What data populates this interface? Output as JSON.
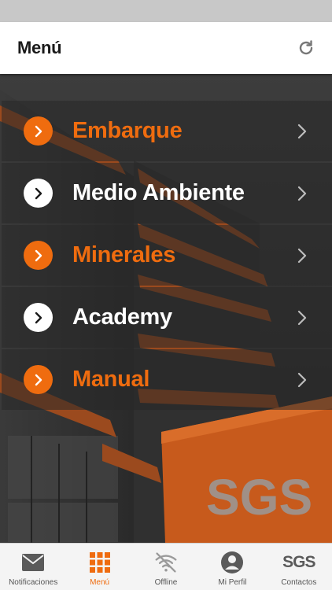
{
  "header": {
    "title": "Menú",
    "refresh_icon": "refresh-icon"
  },
  "colors": {
    "accent": "#ef6c0f",
    "header_bg": "#ffffff",
    "tabbar_bg": "#f4f4f4",
    "status_bar": "#c8c8c8"
  },
  "background": {
    "sign_text": "SGS"
  },
  "menu": {
    "items": [
      {
        "label": "Embarque",
        "color": "#ef6c0f",
        "icon_bg": "#ef6c0f",
        "icon_fg": "#ffffff"
      },
      {
        "label": "Medio Ambiente",
        "color": "#ffffff",
        "icon_bg": "#ffffff",
        "icon_fg": "#1a1a1a"
      },
      {
        "label": "Minerales",
        "color": "#ef6c0f",
        "icon_bg": "#ef6c0f",
        "icon_fg": "#ffffff"
      },
      {
        "label": "Academy",
        "color": "#ffffff",
        "icon_bg": "#ffffff",
        "icon_fg": "#1a1a1a"
      },
      {
        "label": "Manual",
        "color": "#ef6c0f",
        "icon_bg": "#ef6c0f",
        "icon_fg": "#ffffff"
      }
    ]
  },
  "tabs": [
    {
      "label": "Notificaciones",
      "icon": "mail-icon",
      "active": false
    },
    {
      "label": "Menú",
      "icon": "grid-icon",
      "active": true
    },
    {
      "label": "Offline",
      "icon": "wifi-off-icon",
      "active": false
    },
    {
      "label": "Mi Perfil",
      "icon": "profile-icon",
      "active": false
    },
    {
      "label": "Contactos",
      "icon": "sgs-logo-icon",
      "logo_text": "SGS",
      "active": false
    }
  ]
}
